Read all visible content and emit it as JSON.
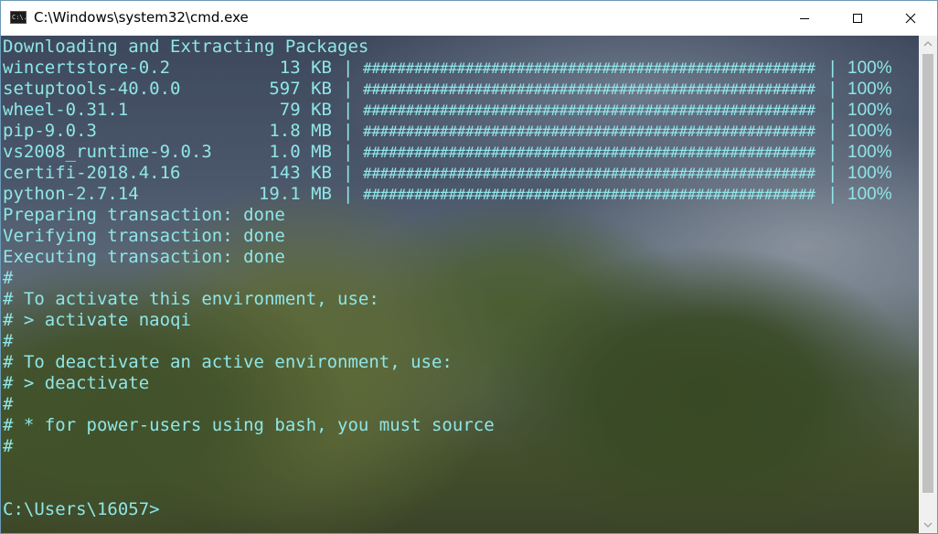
{
  "window": {
    "title": "C:\\Windows\\system32\\cmd.exe",
    "icon_text": "C:\\."
  },
  "controls": {
    "minimize": "minimize-icon",
    "maximize": "maximize-icon",
    "close": "close-icon"
  },
  "colors": {
    "terminal_text": "#8fe6e8",
    "titlebar_bg": "#ffffff"
  },
  "terminal": {
    "header": "Downloading and Extracting Packages",
    "packages": [
      {
        "name": "wincertstore-0.2",
        "size": "13 KB",
        "sep": "|",
        "bar": "##########################################################",
        "sep2": "|",
        "percent": "100%"
      },
      {
        "name": "setuptools-40.0.0",
        "size": "597 KB",
        "sep": "|",
        "bar": "##########################################################",
        "sep2": "|",
        "percent": "100%"
      },
      {
        "name": "wheel-0.31.1",
        "size": "79 KB",
        "sep": "|",
        "bar": "##########################################################",
        "sep2": "|",
        "percent": "100%"
      },
      {
        "name": "pip-9.0.3",
        "size": "1.8 MB",
        "sep": "|",
        "bar": "##########################################################",
        "sep2": "|",
        "percent": "100%"
      },
      {
        "name": "vs2008_runtime-9.0.3",
        "size": "1.0 MB",
        "sep": "|",
        "bar": "##########################################################",
        "sep2": "|",
        "percent": "100%"
      },
      {
        "name": "certifi-2018.4.16",
        "size": "143 KB",
        "sep": "|",
        "bar": "##########################################################",
        "sep2": "|",
        "percent": "100%"
      },
      {
        "name": "python-2.7.14",
        "size": "19.1 MB",
        "sep": "|",
        "bar": "##########################################################",
        "sep2": "|",
        "percent": "100%"
      }
    ],
    "lines": [
      "Preparing transaction: done",
      "Verifying transaction: done",
      "Executing transaction: done",
      "#",
      "# To activate this environment, use:",
      "# > activate naoqi",
      "#",
      "# To deactivate an active environment, use:",
      "# > deactivate",
      "#",
      "# * for power-users using bash, you must source",
      "#"
    ],
    "prompt": "C:\\Users\\16057>"
  }
}
